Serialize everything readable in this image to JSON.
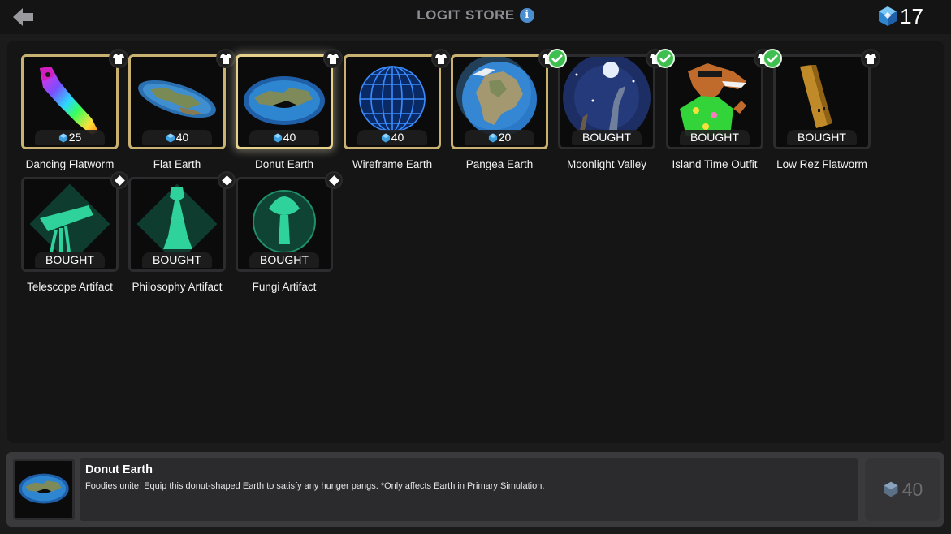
{
  "header": {
    "title": "LOGIT STORE",
    "info_icon": "info-icon",
    "back_icon": "back-arrow-icon",
    "balance": "17",
    "currency_icon": "logit-gem-icon"
  },
  "items": [
    {
      "name": "Dancing Flatworm",
      "price": "25",
      "state": "price",
      "frame": "gold",
      "shirt": true,
      "check": false
    },
    {
      "name": "Flat Earth",
      "price": "40",
      "state": "price",
      "frame": "gold",
      "shirt": true,
      "check": false
    },
    {
      "name": "Donut Earth",
      "price": "40",
      "state": "price",
      "frame": "selected",
      "shirt": true,
      "check": false
    },
    {
      "name": "Wireframe Earth",
      "price": "40",
      "state": "price",
      "frame": "gold",
      "shirt": true,
      "check": false
    },
    {
      "name": "Pangea Earth",
      "price": "20",
      "state": "price",
      "frame": "gold",
      "shirt": true,
      "check": false
    },
    {
      "name": "Moonlight Valley",
      "price": "BOUGHT",
      "state": "bought",
      "frame": "plain",
      "shirt": true,
      "check": true
    },
    {
      "name": "Island Time Outfit",
      "price": "BOUGHT",
      "state": "bought",
      "frame": "plain",
      "shirt": true,
      "check": true
    },
    {
      "name": "Low Rez Flatworm",
      "price": "BOUGHT",
      "state": "bought",
      "frame": "plain",
      "shirt": true,
      "check": true
    },
    {
      "name": "Telescope Artifact",
      "price": "BOUGHT",
      "state": "bought",
      "frame": "plain",
      "diamond": true
    },
    {
      "name": "Philosophy Artifact",
      "price": "BOUGHT",
      "state": "bought",
      "frame": "plain",
      "diamond": true
    },
    {
      "name": "Fungi Artifact",
      "price": "BOUGHT",
      "state": "bought",
      "frame": "plain",
      "diamond": true
    }
  ],
  "detail": {
    "title": "Donut Earth",
    "description": "Foodies unite! Equip this donut-shaped Earth to satisfy any hunger pangs. *Only affects Earth in Primary Simulation.",
    "price": "40"
  },
  "colors": {
    "gold_frame": "#c9b271",
    "check_green": "#3fbf4f",
    "gem_blue": "#3fa0e0",
    "artifact_green": "#2fd29a"
  }
}
